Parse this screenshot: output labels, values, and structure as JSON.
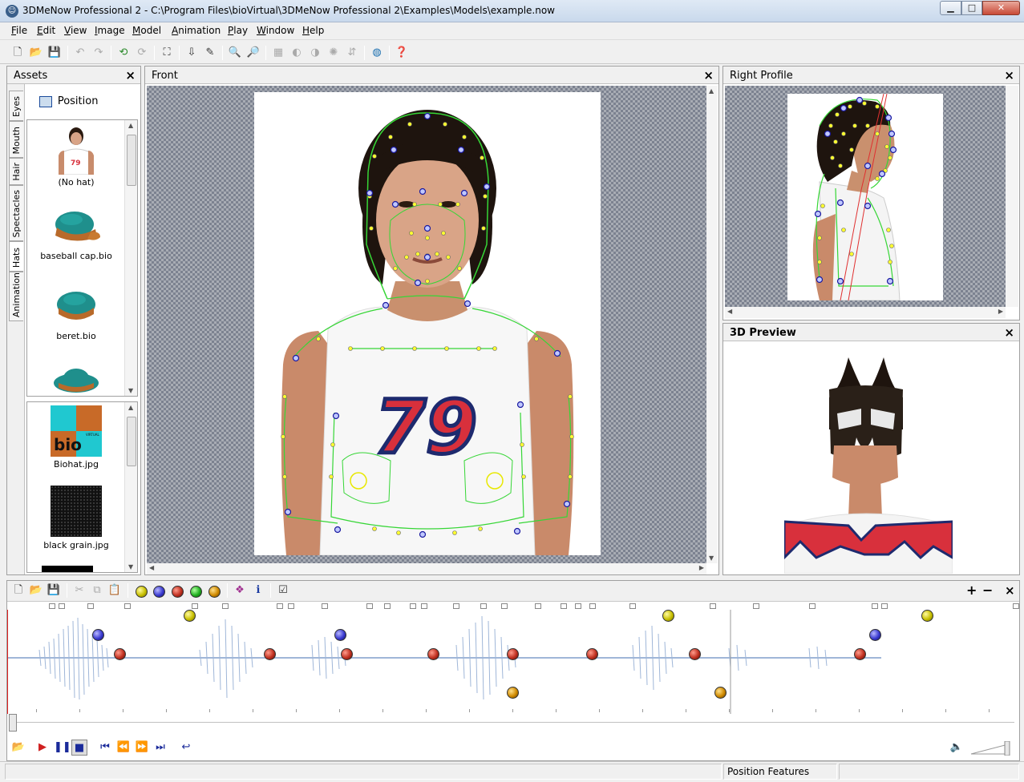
{
  "window": {
    "title": "3DMeNow Professional 2 - C:\\Program Files\\bioVirtual\\3DMeNow Professional 2\\Examples\\Models\\example.now",
    "min_icon": "minimize-icon",
    "max_icon": "maximize-icon",
    "close_icon": "close-icon"
  },
  "menu": [
    "File",
    "Edit",
    "View",
    "Image",
    "Model",
    "Animation",
    "Play",
    "Window",
    "Help"
  ],
  "toolbar_icons": [
    "new-icon",
    "open-icon",
    "save-icon",
    "undo-icon",
    "redo-icon",
    "rotate-left-icon",
    "rotate-right-icon",
    "capture-icon",
    "export-icon",
    "wand-icon",
    "zoom-in-icon",
    "zoom-out-icon",
    "adjust-1-icon",
    "adjust-2-icon",
    "adjust-3-icon",
    "adjust-4-icon",
    "adjust-5-icon",
    "globe-icon",
    "help-icon"
  ],
  "assets": {
    "title": "Assets",
    "close": "×",
    "tabs": [
      "Eyes",
      "Mouth",
      "Hair",
      "Spectacles",
      "Hats",
      "Animation"
    ],
    "active_tab": "Hats",
    "position_button": "Position",
    "items": [
      "(No hat)",
      "baseball cap.bio",
      "beret.bio",
      ""
    ],
    "textures": [
      "Biohat.jpg",
      "black grain.jpg"
    ],
    "texture_brand": "bio",
    "texture_brand_small": "VIRTUAL"
  },
  "front": {
    "title": "Front",
    "close": "×",
    "shirt_number": "79"
  },
  "right_profile": {
    "title": "Right Profile",
    "close": "×"
  },
  "preview": {
    "title": "3D Preview",
    "close": "×"
  },
  "timeline": {
    "plus": "+",
    "minus": "−",
    "close": "×",
    "toolbar_icons": [
      "new-icon",
      "open-icon",
      "save-icon",
      "cut-icon",
      "copy-icon",
      "paste-icon",
      "yellow-ball-icon",
      "blue-ball-icon",
      "red-ball-icon",
      "green-ball-icon",
      "orange-ball-icon",
      "color-mix-icon",
      "info-icon",
      "checklist-icon"
    ]
  },
  "playback_icons": [
    "open-icon",
    "play-icon",
    "pause-icon",
    "stop-icon",
    "first-icon",
    "rewind-icon",
    "forward-icon",
    "last-icon",
    "loop-icon",
    "volume-icon"
  ],
  "status": {
    "left": "",
    "right": "Position Features",
    "extra": ""
  },
  "colors": {
    "accent_green": "#36d636",
    "feature_yellow": "#ffff00",
    "feature_blue": "#2020c0",
    "shirt_red": "#d8303c",
    "shirt_navy": "#1e2a6e",
    "waveform": "#9fb6d8"
  }
}
